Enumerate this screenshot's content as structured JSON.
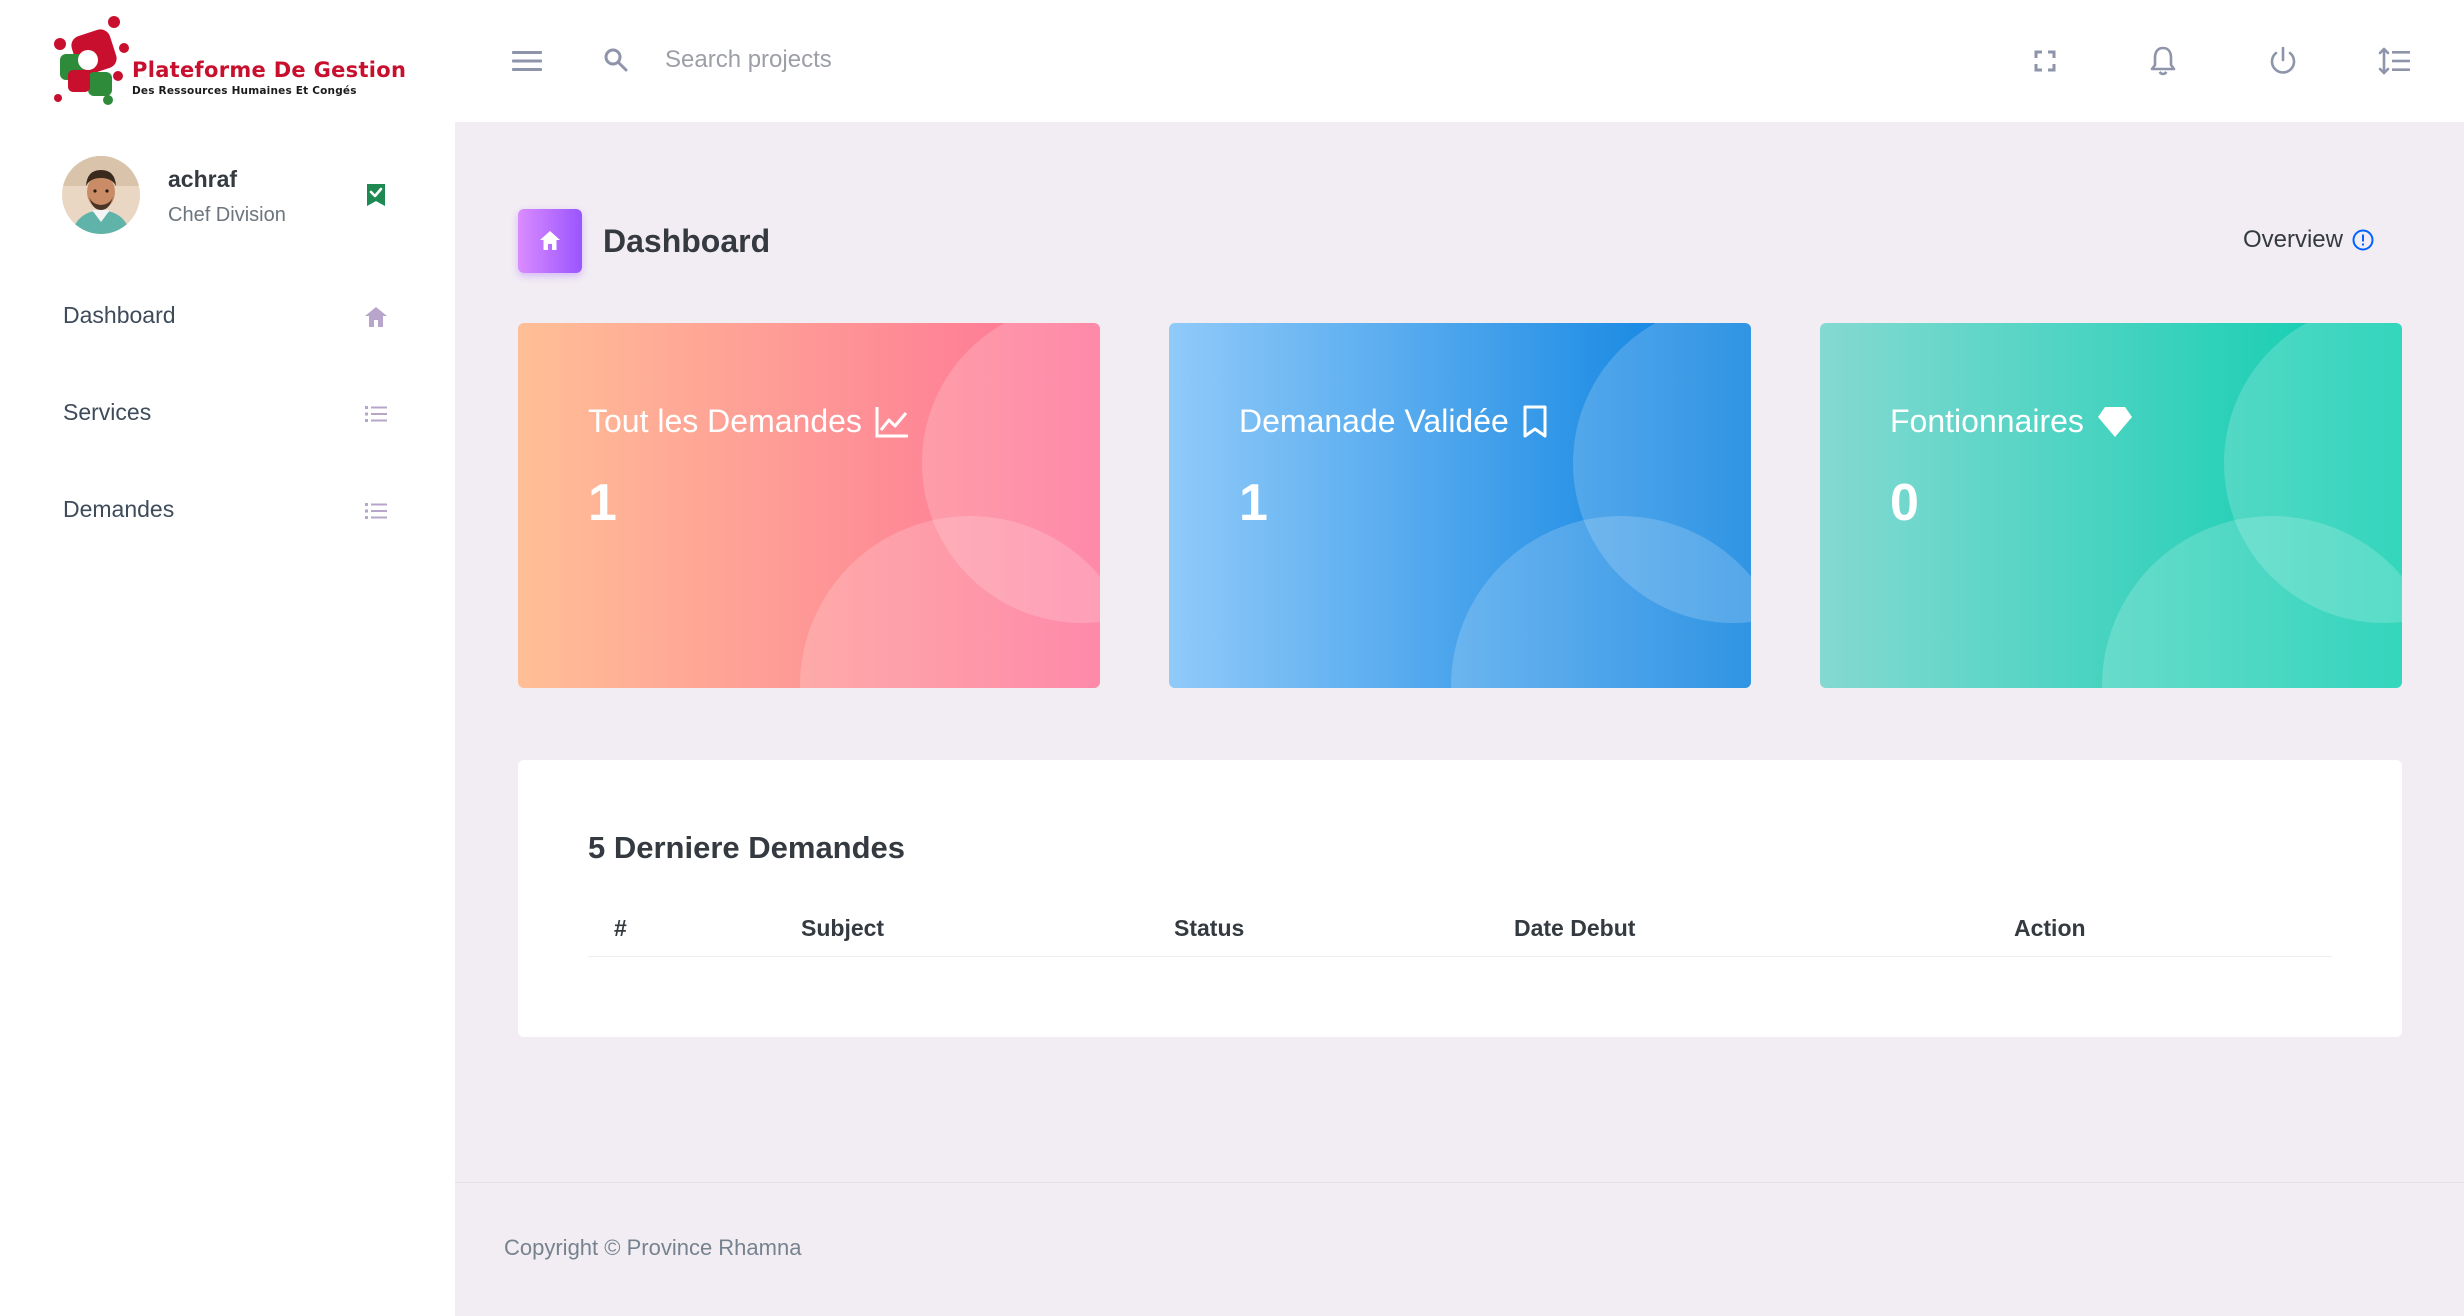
{
  "brand": {
    "title": "Plateforme De Gestion",
    "subtitle": "Des Ressources Humaines Et Congés"
  },
  "user": {
    "name": "achraf",
    "role": "Chef Division"
  },
  "sidebar": {
    "items": [
      {
        "label": "Dashboard",
        "icon": "home-icon"
      },
      {
        "label": "Services",
        "icon": "list-icon"
      },
      {
        "label": "Demandes",
        "icon": "list-icon"
      }
    ]
  },
  "topbar": {
    "search_placeholder": "Search projects",
    "icons": [
      "menu-icon",
      "search-icon",
      "fullscreen-icon",
      "bell-icon",
      "power-icon",
      "line-spacing-icon"
    ]
  },
  "page": {
    "title": "Dashboard",
    "overview_label": "Overview"
  },
  "stats": [
    {
      "title": "Tout les Demandes",
      "value": "1",
      "icon": "chart-line-icon",
      "color_from": "#ffbf96",
      "color_to": "#fe7096"
    },
    {
      "title": "Demanade Validée",
      "value": "1",
      "icon": "bookmark-icon",
      "color_from": "#90caf9",
      "color_to": "#047edf"
    },
    {
      "title": "Fontionnaires",
      "value": "0",
      "icon": "diamond-icon",
      "color_from": "#84d9d2",
      "color_to": "#07cdae"
    }
  ],
  "recent": {
    "title": "5 Derniere Demandes",
    "columns": [
      "#",
      "Subject",
      "Status",
      "Date Debut",
      "Action"
    ],
    "rows": []
  },
  "footer": {
    "copyright": "Copyright © Province Rhamna"
  },
  "colors": {
    "accent": "#b66dff",
    "background": "#f2edf3",
    "nav_icon": "#b8a5cc"
  }
}
